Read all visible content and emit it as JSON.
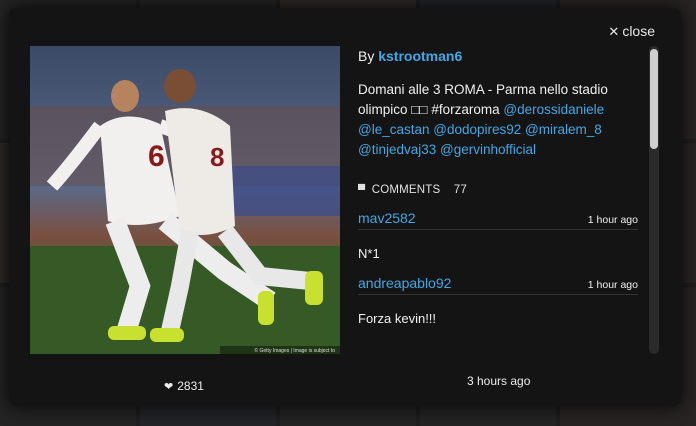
{
  "close": {
    "icon": "close-x-icon",
    "label": "close"
  },
  "post": {
    "by_prefix": "By",
    "author": "kstrootman6",
    "caption_text": "Domani alle 3 ROMA - Parma nello stadio olimpico □□ #forzaroma",
    "mentions": [
      "@derossidaniele",
      "@le_castan",
      "@dodopires92",
      "@miralem_8",
      "@tinjedvaj33",
      "@gervinhofficial"
    ],
    "likes_count": "2831",
    "posted": "3 hours ago",
    "photo_credit": "© Getty Images | Image is subject to"
  },
  "comments_section": {
    "label": "COMMENTS",
    "count": "77",
    "items": [
      {
        "user": "mav2582",
        "time": "1 hour ago",
        "text": "N*1"
      },
      {
        "user": "andreapablo92",
        "time": "1 hour ago",
        "text": "Forza kevin!!!"
      }
    ]
  },
  "colors": {
    "accent": "#3fa8e6",
    "modal_bg": "#141414"
  }
}
